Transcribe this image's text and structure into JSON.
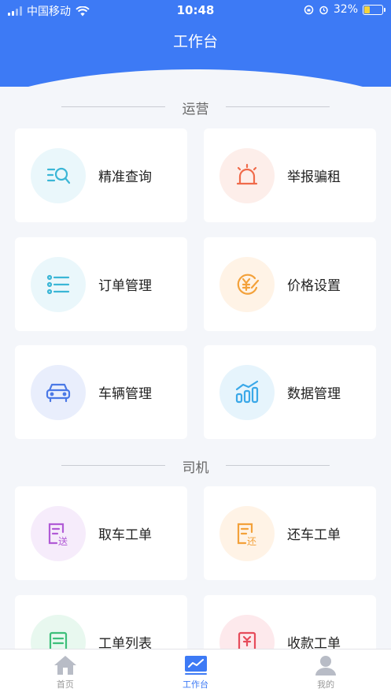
{
  "status_bar": {
    "carrier": "中国移动",
    "time": "10:48",
    "battery": "32%",
    "battery_level": 0.32
  },
  "header": {
    "title": "工作台"
  },
  "sections": [
    {
      "title": "运营"
    },
    {
      "title": "司机"
    }
  ],
  "cards": [
    {
      "label": "精准查询",
      "icon": "precise-search-icon",
      "color": "#3bb6d6",
      "bg": "#eaf7fb"
    },
    {
      "label": "举报骗租",
      "icon": "alarm-light-icon",
      "color": "#f06a4a",
      "bg": "#fdeeea"
    },
    {
      "label": "订单管理",
      "icon": "list-icon",
      "color": "#3bb6d6",
      "bg": "#eaf7fb"
    },
    {
      "label": "价格设置",
      "icon": "yuan-price-icon",
      "color": "#f3a13a",
      "bg": "#fff3e6"
    },
    {
      "label": "车辆管理",
      "icon": "car-icon",
      "color": "#4a78e6",
      "bg": "#e9eefc"
    },
    {
      "label": "数据管理",
      "icon": "bar-chart-icon",
      "color": "#3aa8e8",
      "bg": "#e6f4fc"
    },
    {
      "label": "取车工单",
      "icon": "pickup-ticket-icon",
      "color": "#b15bd6",
      "bg": "#f6ecfb",
      "badge": "送"
    },
    {
      "label": "还车工单",
      "icon": "return-ticket-icon",
      "color": "#f3a13a",
      "bg": "#fff3e6",
      "badge": "还"
    },
    {
      "label": "工单列表",
      "icon": "ticket-list-icon",
      "color": "#3dbf7a",
      "bg": "#e8f8ef"
    },
    {
      "label": "收款工单",
      "icon": "payment-ticket-icon",
      "color": "#e64b5a",
      "bg": "#fde9ec"
    }
  ],
  "tabbar": [
    {
      "label": "首页",
      "icon": "home-icon"
    },
    {
      "label": "工作台",
      "icon": "workbench-chart-icon",
      "active": true
    },
    {
      "label": "我的",
      "icon": "profile-icon"
    }
  ]
}
